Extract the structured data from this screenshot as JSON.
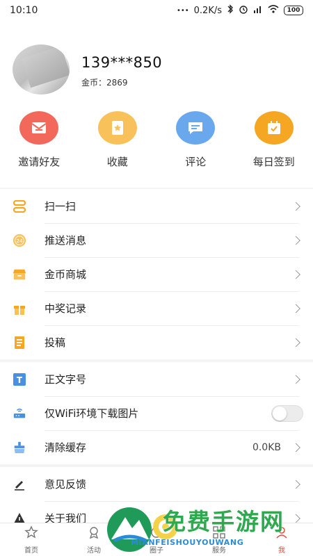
{
  "status_bar": {
    "time": "10:10",
    "dots": "•••",
    "speed": "0.2K/s",
    "battery": "100"
  },
  "profile": {
    "phone": "139***850",
    "coins": "金币：2869"
  },
  "quick_actions": [
    {
      "label": "邀请好友",
      "icon": "mail-icon",
      "color": "#f2695c"
    },
    {
      "label": "收藏",
      "icon": "bookmark-icon",
      "color": "#f8c15a"
    },
    {
      "label": "评论",
      "icon": "comment-icon",
      "color": "#6aa8ee"
    },
    {
      "label": "每日签到",
      "icon": "calendar-check-icon",
      "color": "#f5a623"
    }
  ],
  "menu_section_1": [
    {
      "label": "扫一扫",
      "icon": "scan-icon"
    },
    {
      "label": "推送消息",
      "icon": "push-24-icon"
    },
    {
      "label": "金币商城",
      "icon": "store-icon"
    },
    {
      "label": "中奖记录",
      "icon": "gift-icon"
    },
    {
      "label": "投稿",
      "icon": "notebook-icon"
    }
  ],
  "menu_section_2": [
    {
      "label": "正文字号",
      "icon": "font-size-icon"
    },
    {
      "label": "仅WiFi环境下载图片",
      "icon": "router-icon",
      "toggle": "off"
    },
    {
      "label": "清除缓存",
      "icon": "broom-icon",
      "value": "0.0KB"
    }
  ],
  "menu_section_3": [
    {
      "label": "意见反馈",
      "icon": "pen-icon"
    },
    {
      "label": "关于我们",
      "icon": "info-icon"
    }
  ],
  "tab_bar": [
    {
      "label": "首页",
      "icon": "star-icon"
    },
    {
      "label": "活动",
      "icon": "award-icon"
    },
    {
      "label": "圈子",
      "icon": "circle-icon"
    },
    {
      "label": "服务",
      "icon": "grid-icon"
    },
    {
      "label": "我",
      "icon": "person-icon",
      "active": true
    }
  ],
  "watermark": {
    "title": "免费手游网",
    "subtitle": "MIANFEISHOUYOUWANG"
  },
  "colors": {
    "accent": "#f5a623",
    "tab_active": "#e24b3c"
  }
}
